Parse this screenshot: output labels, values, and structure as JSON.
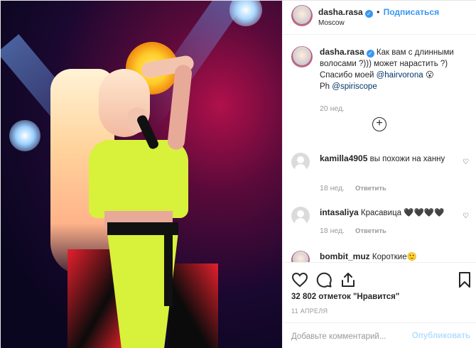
{
  "header": {
    "username": "dasha.rasa",
    "follow_label": "Подписаться",
    "location": "Moscow",
    "more_icon": "more-options-icon"
  },
  "caption": {
    "username": "dasha.rasa",
    "text_before": " Как вам с длинными волосами ?))) может нарастить ?) Спасибо моей ",
    "mention1": "@hairvorona",
    "emoji": " 😮",
    "ph_prefix": "Ph ",
    "mention2": "@spiriscope",
    "time": "20 нед."
  },
  "load_more_icon": "plus-circle-icon",
  "comments": [
    {
      "username": "kamilla4905",
      "text": "вы похожи на ханну",
      "time": "18 нед.",
      "reply": "Ответить"
    },
    {
      "username": "intasaliya",
      "text": "Красавица 🖤🖤🖤🖤",
      "time": "18 нед.",
      "reply": "Ответить"
    },
    {
      "username": "bombit_muz",
      "text": "Короткие🙂"
    }
  ],
  "actions": {
    "like_icon": "heart-icon",
    "comment_icon": "comment-icon",
    "share_icon": "share-icon",
    "save_icon": "bookmark-icon",
    "likes_text": "32 802 отметок \"Нравится\"",
    "date": "11 АПРЕЛЯ"
  },
  "add_comment": {
    "placeholder": "Добавьте комментарий...",
    "publish_label": "Опубликовать"
  },
  "colors": {
    "link": "#3897f0",
    "publish_disabled": "#b2dffc",
    "muted": "#999999"
  }
}
